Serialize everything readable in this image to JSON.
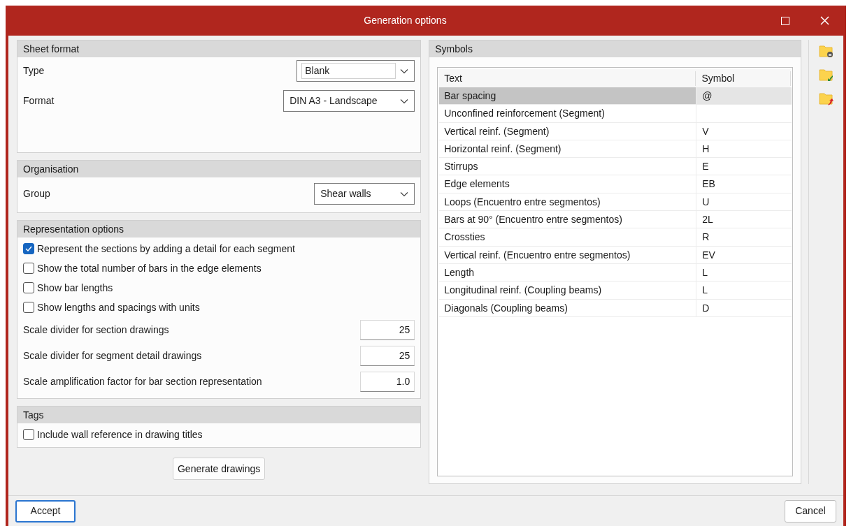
{
  "window": {
    "title": "Generation options"
  },
  "sheet_format": {
    "title": "Sheet format",
    "fields": [
      {
        "label": "Type",
        "value": "Blank",
        "kind": "editable"
      },
      {
        "label": "Format",
        "value": "DIN A3 - Landscape",
        "kind": "select"
      }
    ]
  },
  "organisation": {
    "title": "Organisation",
    "fields": [
      {
        "label": "Group",
        "value": "Shear walls",
        "kind": "select"
      }
    ]
  },
  "representation": {
    "title": "Representation options",
    "options": [
      {
        "kind": "checkbox",
        "label": "Represent the sections by adding a detail for each segment",
        "checked": true
      },
      {
        "kind": "checkbox",
        "label": "Show the total number of bars in the edge elements",
        "checked": false
      },
      {
        "kind": "checkbox",
        "label": "Show bar lengths",
        "checked": false
      },
      {
        "kind": "checkbox",
        "label": "Show lengths and spacings with units",
        "checked": false
      },
      {
        "kind": "number",
        "label": "Scale divider for section drawings",
        "value": "25"
      },
      {
        "kind": "number",
        "label": "Scale divider for segment detail drawings",
        "value": "25"
      },
      {
        "kind": "number",
        "label": "Scale amplification factor for bar section representation",
        "value": "1.0"
      }
    ]
  },
  "tags": {
    "title": "Tags",
    "options": [
      {
        "kind": "checkbox",
        "label": "Include wall reference in drawing titles",
        "checked": false
      }
    ]
  },
  "generate_button": "Generate drawings",
  "symbols": {
    "title": "Symbols",
    "columns": [
      "Text",
      "Symbol"
    ],
    "rows": [
      {
        "text": "Bar spacing",
        "symbol": "@",
        "selected": true
      },
      {
        "text": "Unconfined reinforcement (Segment)",
        "selected": false
      },
      {
        "text": "Vertical reinf. (Segment)",
        "symbol": "V",
        "selected": false
      },
      {
        "text": "Horizontal reinf. (Segment)",
        "symbol": "H",
        "selected": false
      },
      {
        "text": "Stirrups",
        "symbol": "E",
        "selected": false
      },
      {
        "text": "Edge elements",
        "symbol": "EB",
        "selected": false
      },
      {
        "text": "Loops (Encuentro entre segmentos)",
        "symbol": "U",
        "selected": false
      },
      {
        "text": "Bars at 90° (Encuentro entre segmentos)",
        "symbol": "2L",
        "selected": false
      },
      {
        "text": "Crossties",
        "symbol": "R",
        "selected": false
      },
      {
        "text": "Vertical reinf. (Encuentro entre segmentos)",
        "symbol": "EV",
        "selected": false
      },
      {
        "text": "Length",
        "symbol": "L",
        "selected": false
      },
      {
        "text": "Longitudinal reinf. (Coupling beams)",
        "symbol": "L",
        "selected": false
      },
      {
        "text": "Diagonals (Coupling beams)",
        "symbol": "D",
        "selected": false
      }
    ]
  },
  "footer": {
    "accept": "Accept",
    "cancel": "Cancel"
  }
}
